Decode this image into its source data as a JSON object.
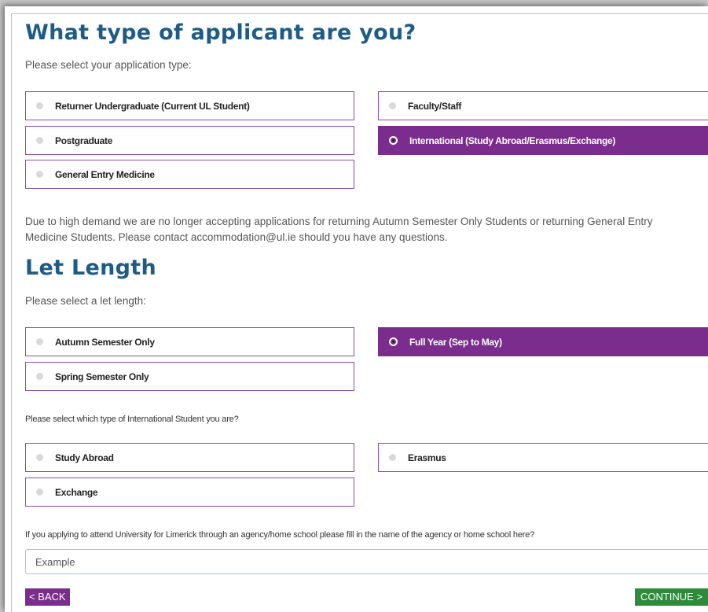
{
  "applicant": {
    "heading": "What type of applicant are you?",
    "prompt": "Please select your application type:",
    "options": [
      {
        "label": "Returner Undergraduate (Current UL Student)",
        "selected": false
      },
      {
        "label": "Faculty/Staff",
        "selected": false
      },
      {
        "label": "Postgraduate",
        "selected": false
      },
      {
        "label": "International (Study Abroad/Erasmus/Exchange)",
        "selected": true
      },
      {
        "label": "General Entry Medicine",
        "selected": false
      }
    ]
  },
  "notice": {
    "line1": "Due to high demand we are no longer accepting applications for returning Autumn Semester Only Students or returning General Entry",
    "line2": "Medicine Students. Please contact accommodation@ul.ie should you have any questions."
  },
  "let_length": {
    "heading": "Let Length",
    "prompt": "Please select a let length:",
    "options": [
      {
        "label": "Autumn Semester Only",
        "selected": false
      },
      {
        "label": "Full Year (Sep to May)",
        "selected": true
      },
      {
        "label": "Spring Semester Only",
        "selected": false
      }
    ]
  },
  "intl_type": {
    "prompt": "Please select which type of International Student you are?",
    "options": [
      {
        "label": "Study Abroad",
        "selected": false
      },
      {
        "label": "Erasmus",
        "selected": false
      },
      {
        "label": "Exchange",
        "selected": false
      }
    ]
  },
  "agency": {
    "prompt": "If you applying to attend University for Limerick through an agency/home school please fill in the name of the agency or home school here?",
    "value": "Example"
  },
  "nav": {
    "back_label": "< BACK",
    "continue_label": "CONTINUE >"
  },
  "colors": {
    "heading": "#1e5c86",
    "selected_bg": "#7a2d8c",
    "border": "#8a4ba6",
    "continue_bg": "#2e8b3a"
  }
}
